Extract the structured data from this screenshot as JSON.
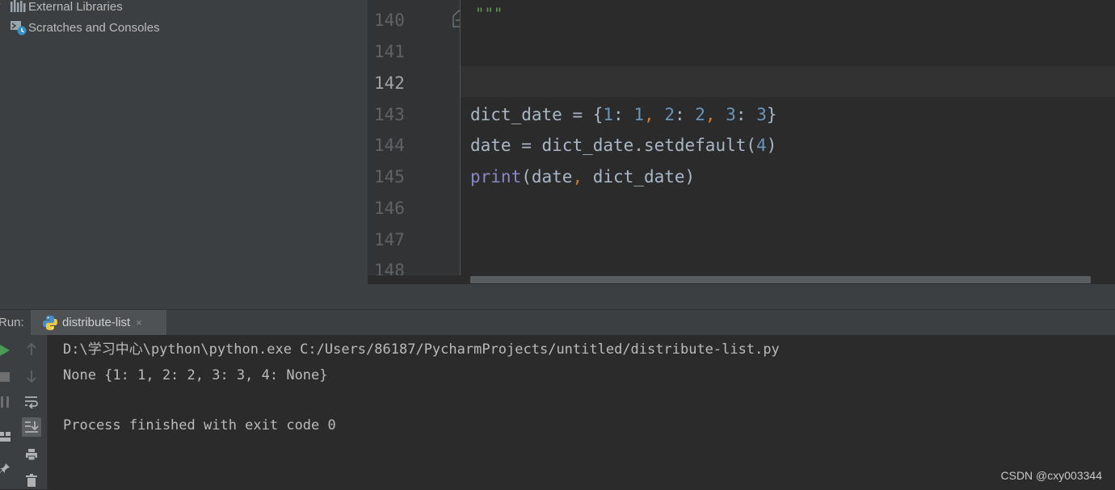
{
  "project_tree": {
    "items": [
      {
        "label": "External Libraries",
        "icon": "library-icon"
      },
      {
        "label": "Scratches and Consoles",
        "icon": "scratches-icon"
      }
    ]
  },
  "editor": {
    "line_numbers": [
      "140",
      "141",
      "142",
      "143",
      "144",
      "145",
      "146",
      "147",
      "148"
    ],
    "current_line": "142",
    "code": {
      "l140": "\"\"\"",
      "l143": {
        "var": "dict_date",
        "assign": " = ",
        "open": "{",
        "k1": "1",
        "colon1": ": ",
        "v1": "1",
        "sep1": ",",
        "k2": "2",
        "colon2": ": ",
        "v2": "2",
        "sep2": ",",
        "k3": "3",
        "colon3": ": ",
        "v3": "3",
        "close": "}"
      },
      "l144": {
        "var": "date",
        "assign": " = ",
        "call": "dict_date.setdefault(",
        "arg": "4",
        "close": ")"
      },
      "l145": {
        "fn": "print",
        "open": "(",
        "arg1": "date",
        "sep": ",",
        "arg2": " dict_date",
        "close": ")"
      }
    },
    "h_scroll_fraction": 0.86
  },
  "run": {
    "label": "Run:",
    "tab_label": "distribute-list",
    "close_glyph": "×",
    "console": [
      "D:\\学习中心\\python\\python.exe C:/Users/86187/PycharmProjects/untitled/distribute-list.py",
      "None {1: 1, 2: 2, 3: 3, 4: None}",
      "",
      "Process finished with exit code 0"
    ]
  },
  "colors": {
    "background": "#2b2b2b",
    "panel": "#3c3f41",
    "keyword": "#cc7832",
    "number": "#6897bb",
    "builtin": "#8888c6",
    "run_green": "#499c54"
  },
  "watermark": "CSDN @cxy003344"
}
